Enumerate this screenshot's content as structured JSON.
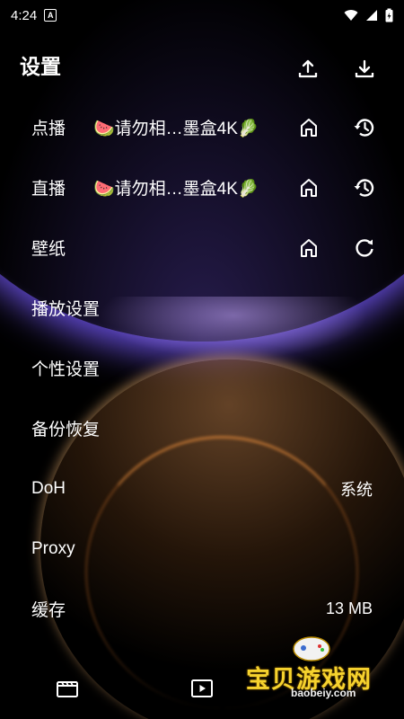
{
  "status_bar": {
    "time": "4:24",
    "notification_letter": "A"
  },
  "header": {
    "title": "设置",
    "upload_icon": "upload-icon",
    "download_icon": "download-icon"
  },
  "rows": [
    {
      "label": "点播",
      "source": "🍉请勿相…墨盒4K🥬"
    },
    {
      "label": "直播",
      "source": "🍉请勿相…墨盒4K🥬"
    },
    {
      "label": "壁纸"
    },
    {
      "label": "播放设置"
    },
    {
      "label": "个性设置"
    },
    {
      "label": "备份恢复"
    },
    {
      "label": "DoH",
      "value": "系统"
    },
    {
      "label": "Proxy"
    },
    {
      "label": "缓存",
      "value": "13 MB"
    }
  ],
  "watermark": {
    "text": "宝贝游戏网",
    "url": "baobeiy.com"
  },
  "bottom_nav": [
    "film-icon",
    "play-icon"
  ]
}
